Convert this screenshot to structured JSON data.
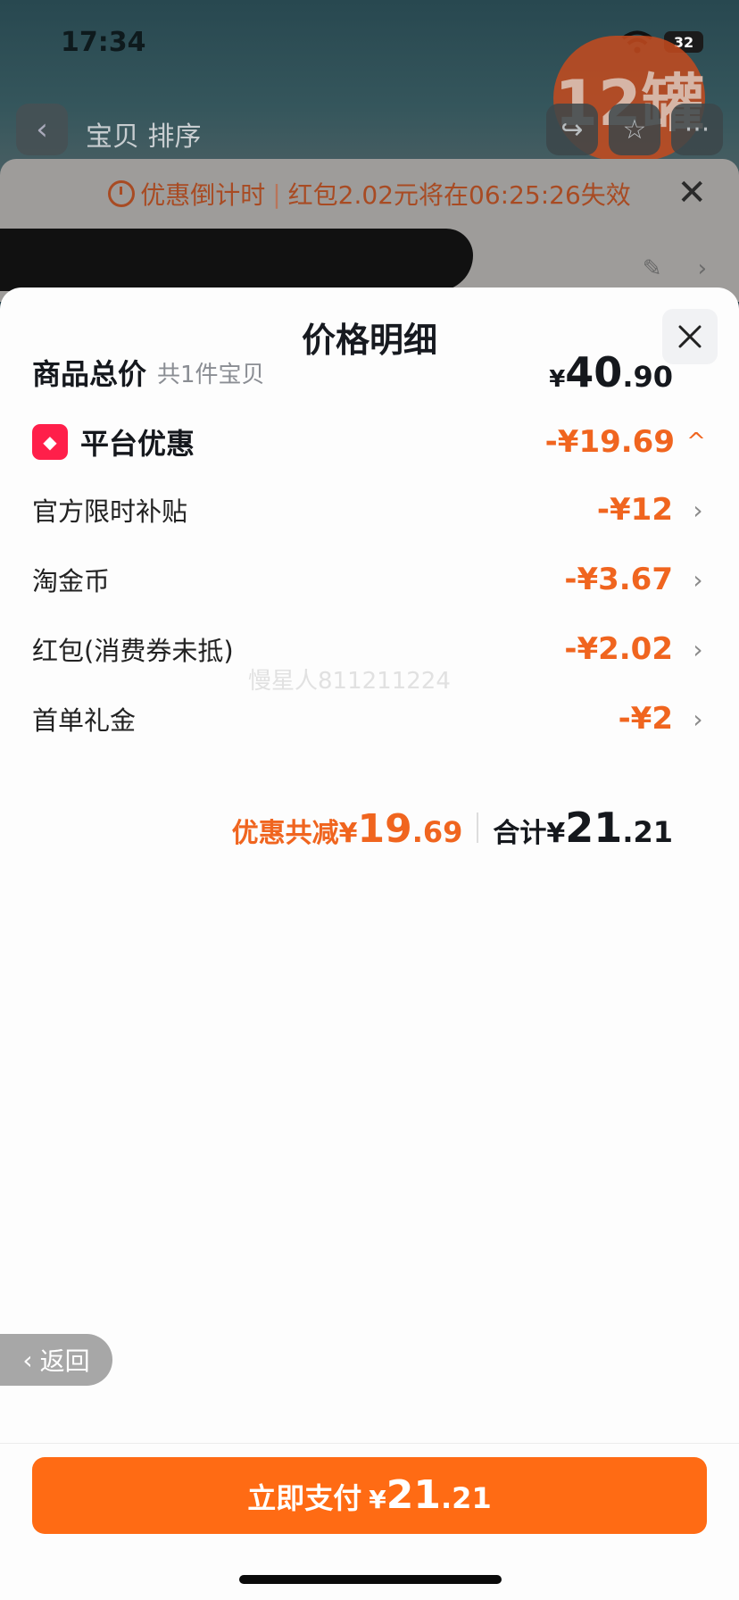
{
  "status_bar": {
    "time": "17:34",
    "battery": "32"
  },
  "background": {
    "nav_title": "宝贝  排序",
    "promo_badge": "12罐",
    "timer": {
      "prefix": "优惠倒计时",
      "text": "红包2.02元将在06:25:26失效"
    }
  },
  "sheet": {
    "title": "价格明细",
    "total": {
      "label": "商品总价",
      "sub": "共1件宝贝",
      "yen": "¥",
      "int": "40",
      "dec": ".90"
    },
    "platform": {
      "icon": "tag-icon",
      "label": "平台优惠",
      "value": "-¥19.69"
    },
    "items": [
      {
        "label": "官方限时补贴",
        "value": "-¥12"
      },
      {
        "label": "淘金币",
        "value": "-¥3.67"
      },
      {
        "label": "红包(消费券未抵)",
        "value": "-¥2.02"
      },
      {
        "label": "首单礼金",
        "value": "-¥2"
      }
    ],
    "summary": {
      "discount_label": "优惠共减¥",
      "discount_int": "19",
      "discount_dec": ".69",
      "total_label": "合计¥",
      "total_int": "21",
      "total_dec": ".21"
    },
    "watermark": "慢星人811211224",
    "back_label": "返回",
    "pay_button": {
      "label": "立即支付",
      "yen": "¥",
      "int": "21",
      "dec": ".21"
    }
  },
  "colors": {
    "accent": "#ff6b14",
    "discount": "#f0651f",
    "tag": "#ff1f4a"
  }
}
